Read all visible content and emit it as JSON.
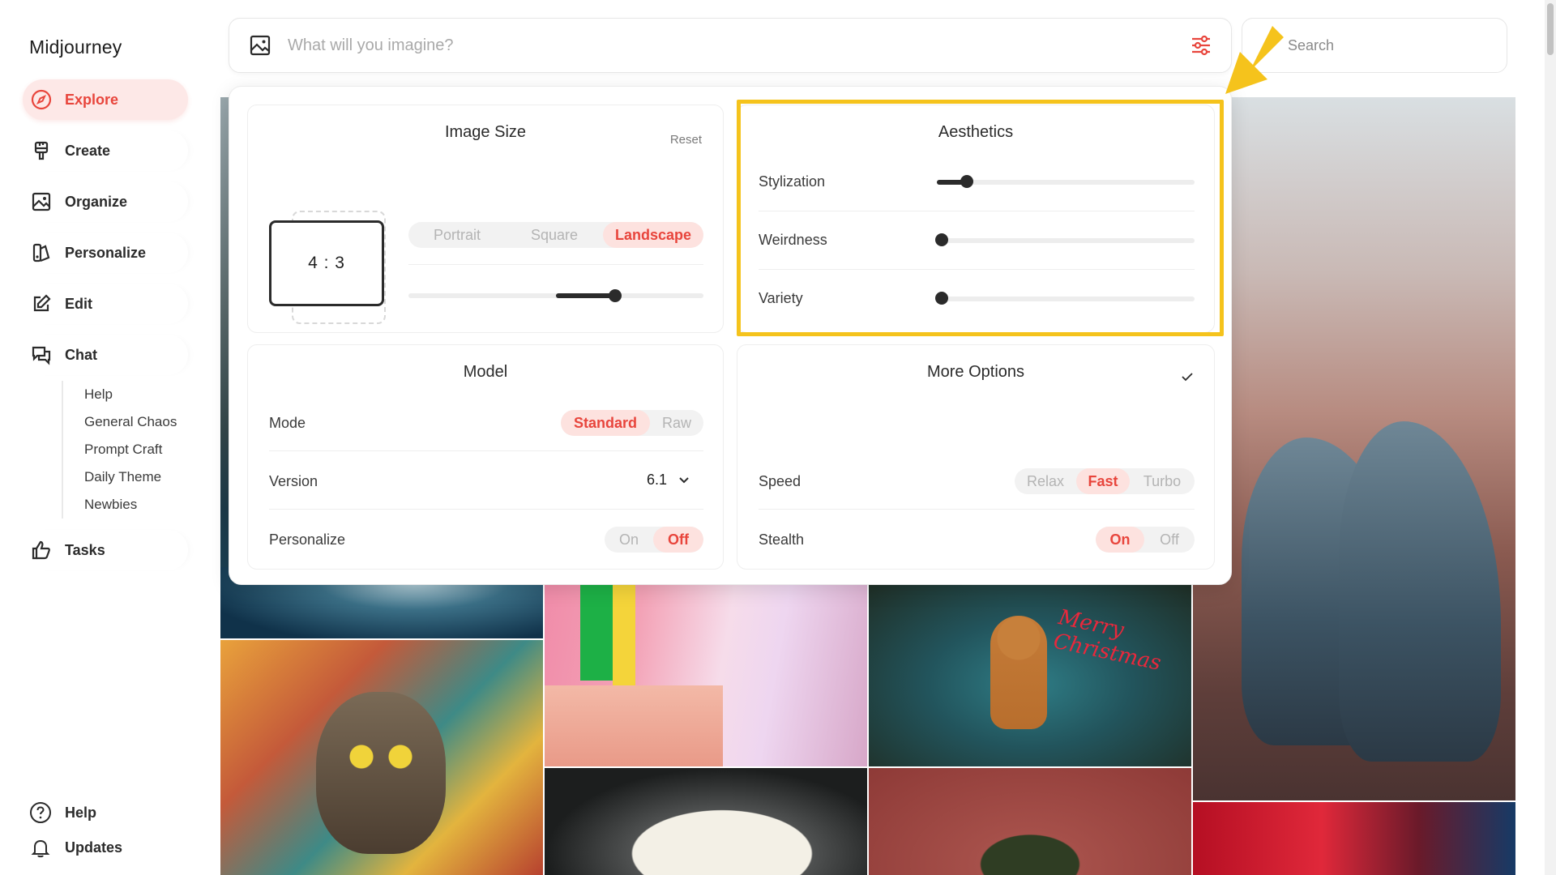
{
  "app": {
    "name": "Midjourney"
  },
  "sidebar": {
    "items": [
      {
        "label": "Explore",
        "icon": "compass-icon",
        "active": true
      },
      {
        "label": "Create",
        "icon": "brush-icon"
      },
      {
        "label": "Organize",
        "icon": "image-icon"
      },
      {
        "label": "Personalize",
        "icon": "palette-icon"
      },
      {
        "label": "Edit",
        "icon": "edit-icon"
      },
      {
        "label": "Chat",
        "icon": "chat-icon"
      }
    ],
    "chat_channels": [
      "Help",
      "General Chaos",
      "Prompt Craft",
      "Daily Theme",
      "Newbies"
    ],
    "tasks": {
      "label": "Tasks",
      "icon": "thumbs-up-icon"
    },
    "bottom": [
      {
        "label": "Help",
        "icon": "help-circle-icon"
      },
      {
        "label": "Updates",
        "icon": "bell-icon"
      }
    ]
  },
  "prompt": {
    "placeholder": "What will you imagine?",
    "value": ""
  },
  "search": {
    "placeholder": "Search"
  },
  "settings": {
    "image_size": {
      "title": "Image Size",
      "reset_label": "Reset",
      "ratio": "4 : 3",
      "orientation_options": [
        "Portrait",
        "Square",
        "Landscape"
      ],
      "orientation_selected": "Landscape",
      "ratio_slider_position": 0.7
    },
    "aesthetics": {
      "title": "Aesthetics",
      "sliders": [
        {
          "label": "Stylization",
          "value": 0.1
        },
        {
          "label": "Weirdness",
          "value": 0
        },
        {
          "label": "Variety",
          "value": 0
        }
      ]
    },
    "model": {
      "title": "Model",
      "mode_label": "Mode",
      "mode_options": [
        "Standard",
        "Raw"
      ],
      "mode_selected": "Standard",
      "version_label": "Version",
      "version_value": "6.1",
      "personalize_label": "Personalize",
      "personalize_options": [
        "On",
        "Off"
      ],
      "personalize_selected": "Off"
    },
    "more_options": {
      "title": "More Options",
      "speed_label": "Speed",
      "speed_options": [
        "Relax",
        "Fast",
        "Turbo"
      ],
      "speed_selected": "Fast",
      "stealth_label": "Stealth",
      "stealth_options": [
        "On",
        "Off"
      ],
      "stealth_selected": "On"
    }
  },
  "gallery": {
    "tiles": [
      "mountain-lake",
      "ocean-wave",
      "pink-architecture",
      "gingerbread-christmas",
      "wolves-fog",
      "cat-collage",
      "white-sphere",
      "holly-portrait",
      "neon-portrait"
    ],
    "gingerbread_text": "Merry Christmas"
  },
  "colors": {
    "accent": "#e8453c",
    "accent_bg": "#fde2df",
    "highlight": "#f5c31c"
  }
}
